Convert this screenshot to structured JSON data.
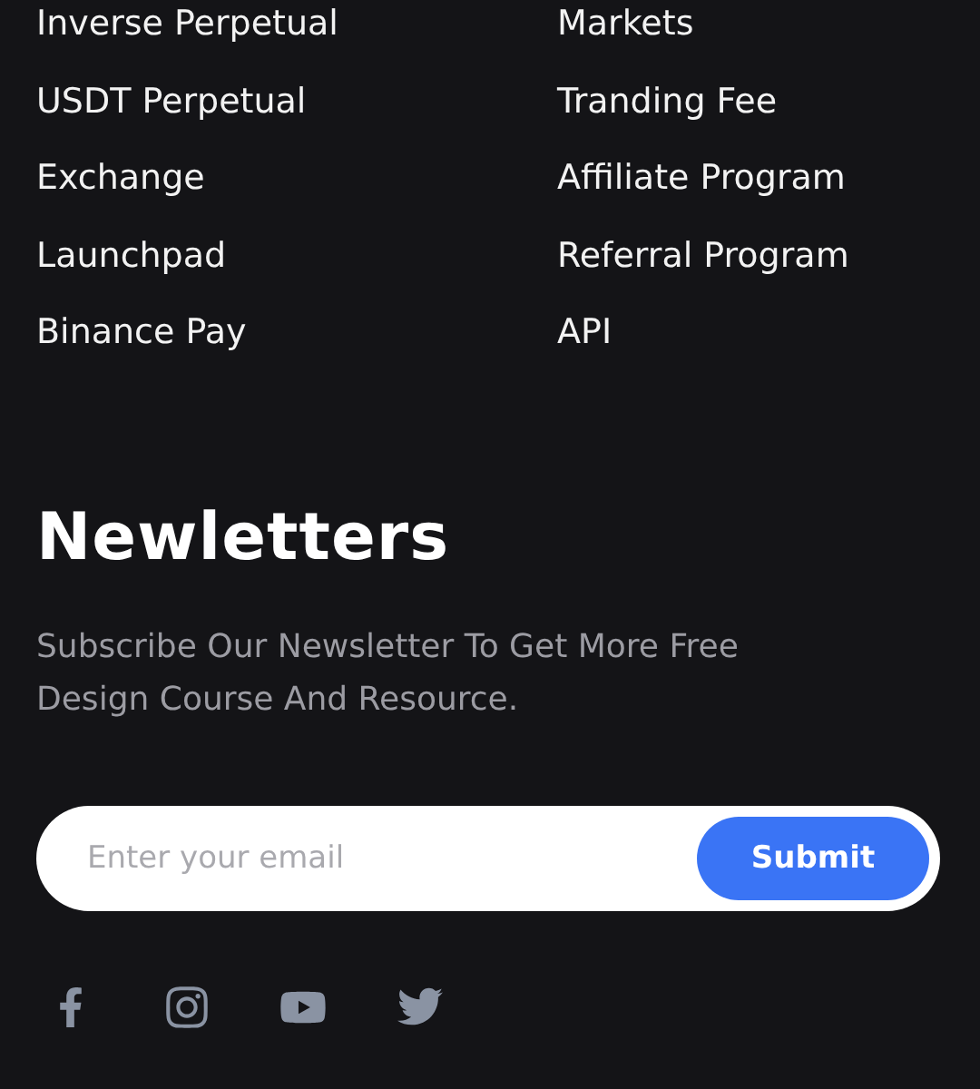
{
  "link_columns": [
    {
      "links": [
        "Inverse Perpetual",
        "USDT Perpetual",
        "Exchange",
        "Launchpad",
        "Binance Pay"
      ]
    },
    {
      "links": [
        "Markets",
        "Tranding Fee",
        "Affiliate Program",
        "Referral Program",
        "API"
      ]
    }
  ],
  "newsletter": {
    "title": "Newletters",
    "description": "Subscribe Our Newsletter To Get More Free Design Course And Resource.",
    "email_field": {
      "placeholder": "Enter your email"
    },
    "submit_button": "Submit"
  },
  "social_links": [
    {
      "kind": "facebook"
    },
    {
      "kind": "instagram"
    },
    {
      "kind": "youtube"
    },
    {
      "kind": "twitter"
    }
  ]
}
